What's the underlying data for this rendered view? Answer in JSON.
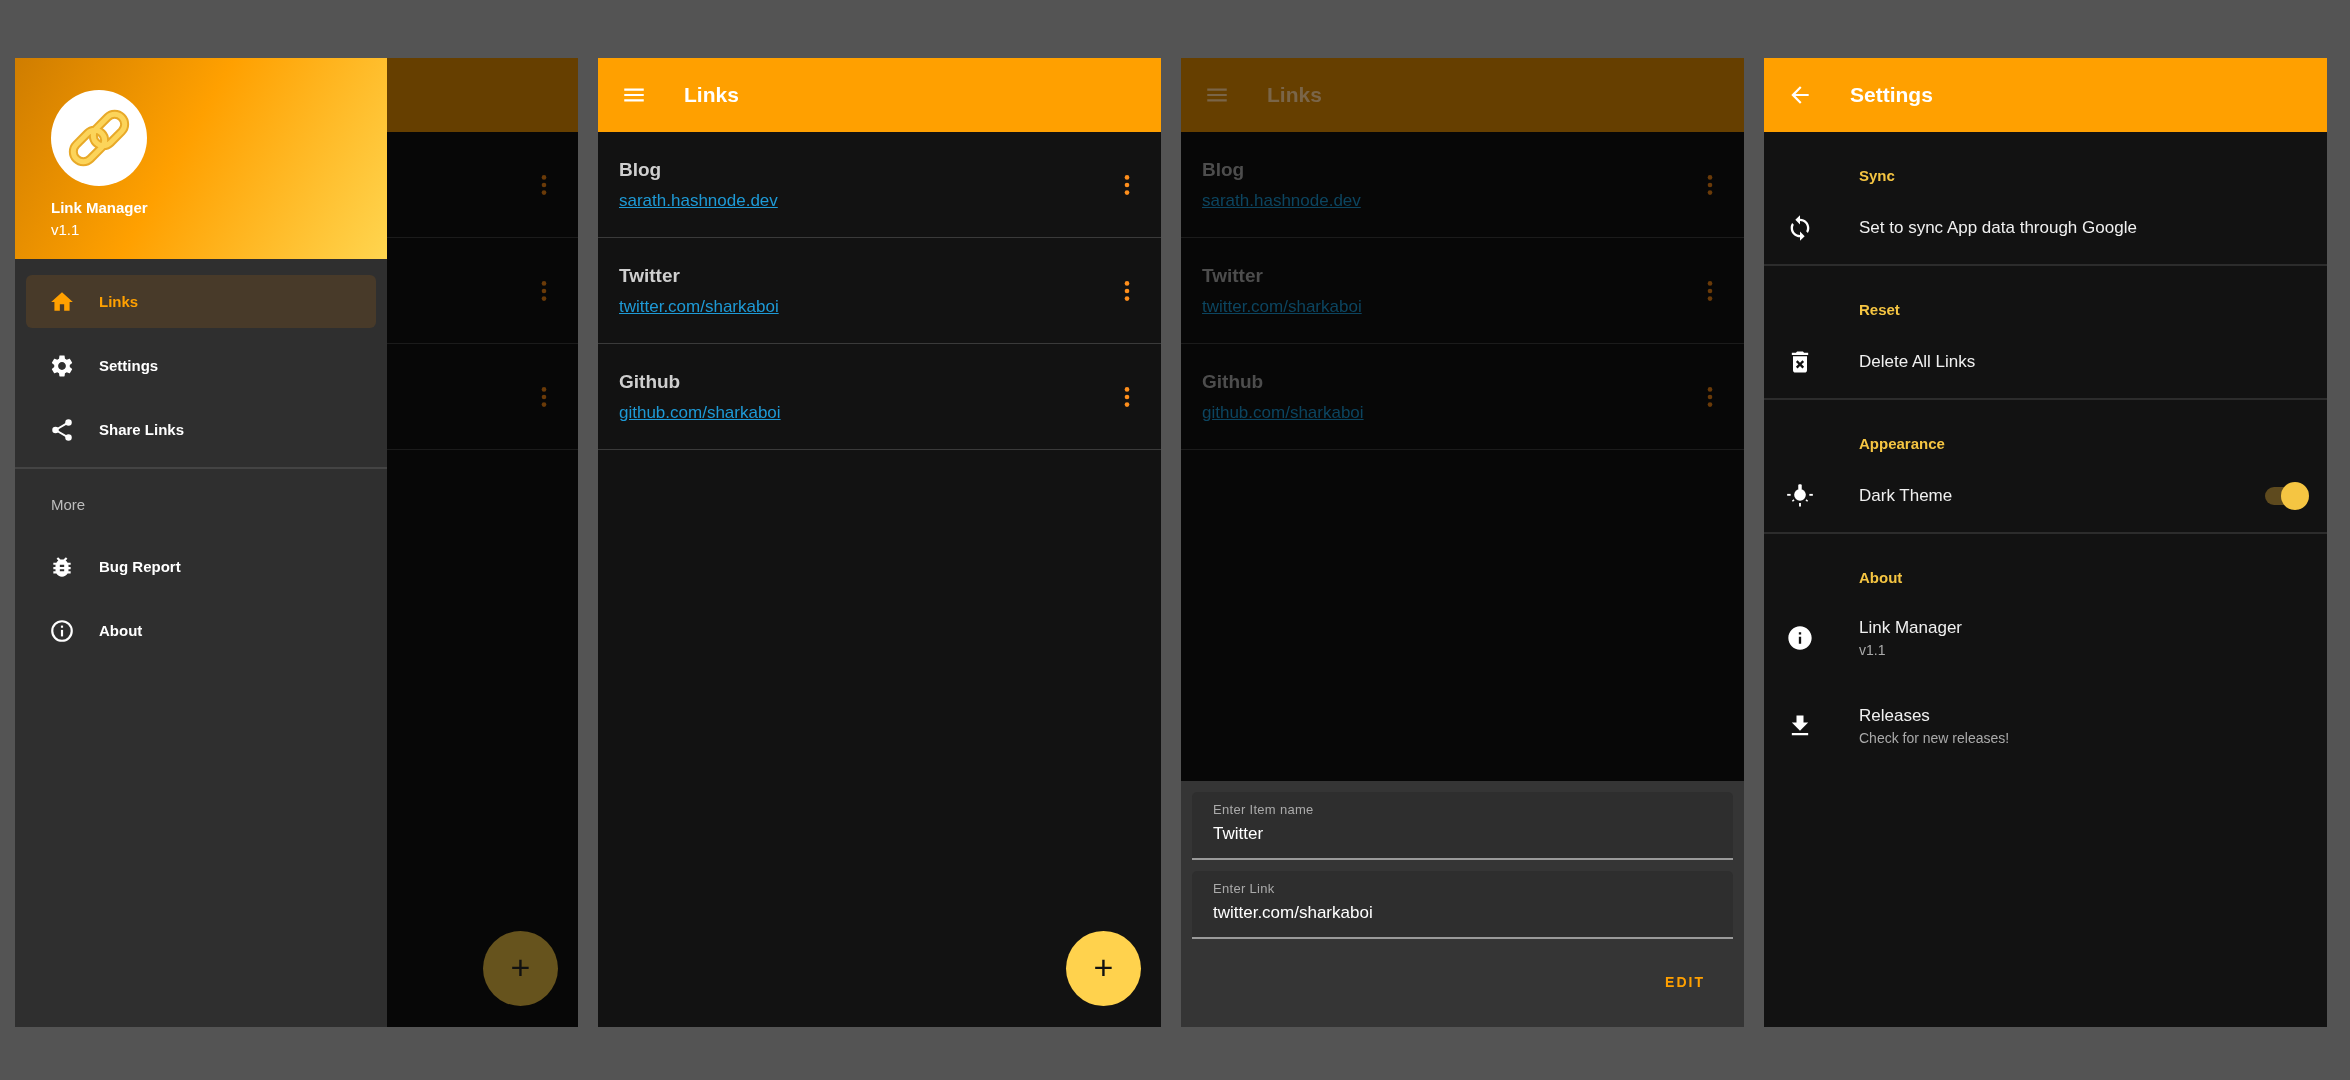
{
  "screens": [
    {
      "kind": "drawer",
      "fab": "+",
      "header": {
        "title": "Link Manager",
        "version": "v1.1"
      },
      "items": [
        {
          "label": "Links",
          "selected": true
        },
        {
          "label": "Settings",
          "selected": false
        },
        {
          "label": "Share Links",
          "selected": false
        }
      ],
      "section": "More",
      "more_items": [
        {
          "label": "Bug Report",
          "selected": false
        },
        {
          "label": "About",
          "selected": false
        }
      ]
    },
    {
      "kind": "links",
      "title": "Links",
      "fab": "+",
      "links": [
        {
          "name": "Blog",
          "url": "sarath.hashnode.dev"
        },
        {
          "name": "Twitter",
          "url": "twitter.com/sharkaboi"
        },
        {
          "name": "Github",
          "url": "github.com/sharkaboi"
        }
      ]
    },
    {
      "kind": "edit",
      "title": "Links",
      "links": [
        {
          "name": "Blog",
          "url": "sarath.hashnode.dev"
        },
        {
          "name": "Twitter",
          "url": "twitter.com/sharkaboi"
        },
        {
          "name": "Github",
          "url": "github.com/sharkaboi"
        }
      ],
      "sheet": {
        "fields": [
          {
            "label": "Enter Item name",
            "value": "Twitter"
          },
          {
            "label": "Enter Link",
            "value": "twitter.com/sharkaboi"
          }
        ],
        "action": "EDIT"
      }
    },
    {
      "kind": "settings",
      "title": "Settings",
      "sections": [
        {
          "heading": "Sync",
          "items": [
            {
              "kind": "plain",
              "title": "Set to sync App data through Google"
            }
          ]
        },
        {
          "heading": "Reset",
          "items": [
            {
              "kind": "plain",
              "title": "Delete All Links"
            }
          ]
        },
        {
          "heading": "Appearance",
          "items": [
            {
              "kind": "switch",
              "title": "Dark Theme",
              "on": true
            }
          ]
        },
        {
          "heading": "About",
          "items": [
            {
              "kind": "plain",
              "title": "Link Manager",
              "subtitle": "v1.1"
            },
            {
              "kind": "plain",
              "title": "Releases",
              "subtitle": "Check for new releases!"
            }
          ]
        }
      ]
    }
  ]
}
